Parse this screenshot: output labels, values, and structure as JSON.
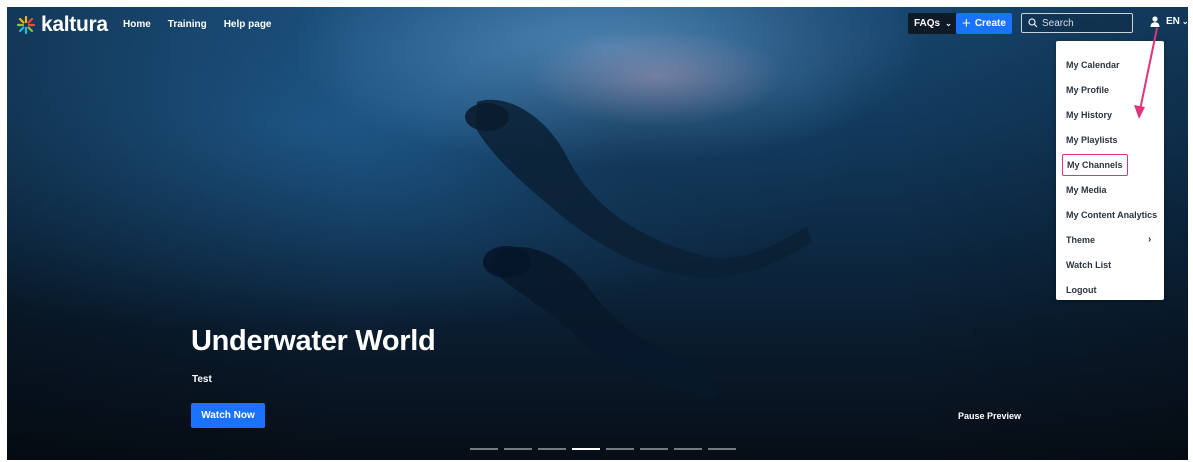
{
  "brand": {
    "name": "kaltura"
  },
  "nav": {
    "items": [
      "Home",
      "Training",
      "Help page"
    ]
  },
  "header": {
    "faqs_label": "FAQs",
    "create_label": "Create",
    "search_placeholder": "Search",
    "language": "EN"
  },
  "user_menu": {
    "items": [
      {
        "label": "My Calendar"
      },
      {
        "label": "My Profile"
      },
      {
        "label": "My History"
      },
      {
        "label": "My Playlists"
      },
      {
        "label": "My Channels",
        "highlighted": true
      },
      {
        "label": "My Media"
      },
      {
        "label": "My Content Analytics"
      },
      {
        "label": "Theme",
        "has_submenu": true
      },
      {
        "label": "Watch List"
      },
      {
        "label": "Logout"
      }
    ]
  },
  "hero": {
    "title": "Underwater World",
    "subtitle": "Test",
    "watch_label": "Watch Now",
    "pause_label": "Pause Preview",
    "slides_count": 8,
    "active_slide": 4
  },
  "colors": {
    "accent": "#1a73ff",
    "highlight": "#e0347a",
    "menu_text": "#2b3440"
  }
}
